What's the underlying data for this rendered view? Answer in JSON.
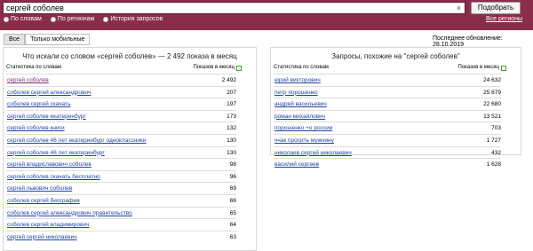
{
  "search": {
    "value": "сергей соболев",
    "clear": "×",
    "button": "Подобрать"
  },
  "modes": [
    {
      "label": "По словам",
      "selected": true
    },
    {
      "label": "По регионам",
      "selected": false
    },
    {
      "label": "История запросов",
      "selected": false
    }
  ],
  "regions_link": "Все регионы",
  "tabs": [
    {
      "label": "Все",
      "active": true
    },
    {
      "label": "Только мобильные",
      "active": false
    }
  ],
  "last_updated": "Последнее обновление: 28.10.2019",
  "left": {
    "title": "Что искали со словом «сергей соболев» — 2 492 показа в месяц",
    "col_query": "Статистика по словам",
    "col_count": "Показов в месяц",
    "rows": [
      {
        "q": "сергей соболев",
        "n": "2 492",
        "visited": true
      },
      {
        "q": "соболев сергей александрович",
        "n": "207"
      },
      {
        "q": "соболев сергей скачать",
        "n": "197"
      },
      {
        "q": "сергей соболев екатеринбург",
        "n": "173"
      },
      {
        "q": "сергей соболев книги",
        "n": "132"
      },
      {
        "q": "сергей соболев 46 лет екатеринбург одноклассники",
        "n": "130"
      },
      {
        "q": "сергей соболев 46 лет екатеринбург",
        "n": "130"
      },
      {
        "q": "сергей владиславович соболев",
        "n": "98"
      },
      {
        "q": "сергей соболев скачать бесплатно",
        "n": "96"
      },
      {
        "q": "сергей львович соболев",
        "n": "69"
      },
      {
        "q": "соболев сергей биография",
        "n": "66"
      },
      {
        "q": "соболев сергей александрович правительство",
        "n": "65"
      },
      {
        "q": "соболев сергей владимирович",
        "n": "64"
      },
      {
        "q": "сергей сергей николаевич",
        "n": "63"
      }
    ]
  },
  "right": {
    "title": "Запросы, похожие на \"сергей соболев\"",
    "col_query": "Статистика по словам",
    "col_count": "Показов в месяц",
    "rows": [
      {
        "q": "юрий викторович",
        "n": "24 632"
      },
      {
        "q": "петр порошенко",
        "n": "25 879"
      },
      {
        "q": "андрей васильевич",
        "n": "22 680"
      },
      {
        "q": "роман михайлович",
        "n": "13 521"
      },
      {
        "q": "порошенко +о россии",
        "n": "703"
      },
      {
        "q": "ччак просить мужчину",
        "n": "1 727"
      },
      {
        "q": "николаев сергей николаевич",
        "n": "432"
      },
      {
        "q": "василий сергеев",
        "n": "1 628"
      }
    ]
  }
}
